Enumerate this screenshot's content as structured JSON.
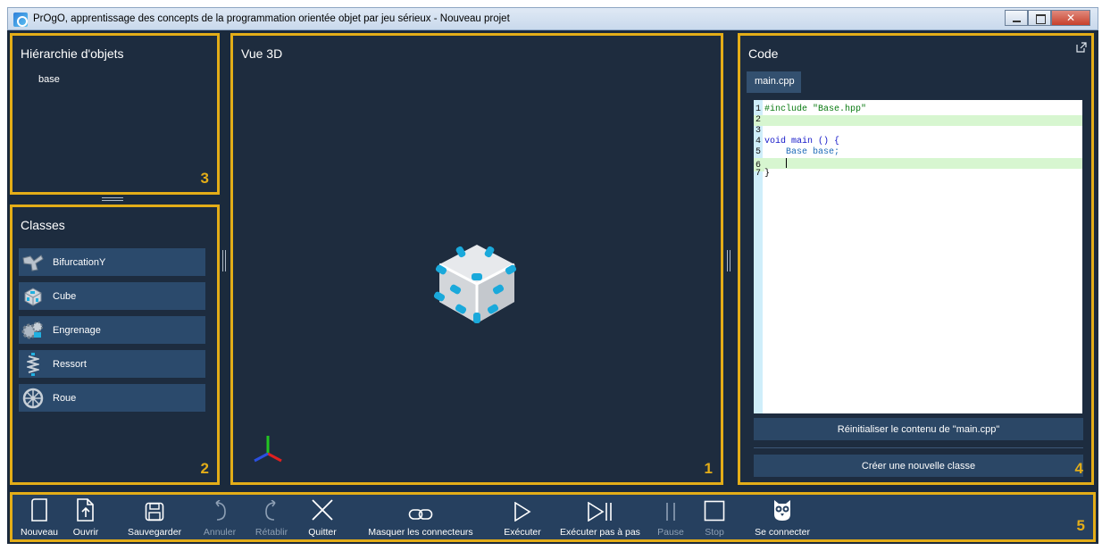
{
  "window": {
    "title": "PrOgO, apprentissage des concepts de la programmation orientée objet par jeu sérieux - Nouveau projet"
  },
  "panels": {
    "hierarchy": {
      "title": "Hiérarchie d'objets",
      "number": "3",
      "items": [
        "base"
      ]
    },
    "classes": {
      "title": "Classes",
      "number": "2",
      "items": [
        {
          "label": "BifurcationY",
          "icon": "bifurcation-icon"
        },
        {
          "label": "Cube",
          "icon": "cube-icon"
        },
        {
          "label": "Engrenage",
          "icon": "gear-piece-icon"
        },
        {
          "label": "Ressort",
          "icon": "spring-icon"
        },
        {
          "label": "Roue",
          "icon": "wheel-icon"
        }
      ]
    },
    "view3d": {
      "title": "Vue 3D",
      "number": "1"
    },
    "code": {
      "title": "Code",
      "number": "4",
      "tab": "main.cpp",
      "lines": [
        {
          "n": "1",
          "text": "#include \"Base.hpp\"",
          "highlight": false
        },
        {
          "n": "2",
          "text": "",
          "highlight": true
        },
        {
          "n": "3",
          "text": "",
          "highlight": false
        },
        {
          "n": "4",
          "text": "void main () {",
          "highlight": false
        },
        {
          "n": "5",
          "text": "    Base base;",
          "highlight": false
        },
        {
          "n": "6",
          "text": "    ",
          "highlight": true
        },
        {
          "n": "7",
          "text": "}",
          "highlight": false
        }
      ],
      "reset_button": "Réinitialiser le contenu de \"main.cpp\"",
      "new_class_button": "Créer une nouvelle classe"
    },
    "toolbar": {
      "number": "5",
      "buttons": [
        {
          "label": "Nouveau",
          "icon": "new-file-icon",
          "enabled": true
        },
        {
          "label": "Ouvrir",
          "icon": "open-file-icon",
          "enabled": true
        },
        {
          "label": "Sauvegarder",
          "icon": "save-icon",
          "enabled": true
        },
        {
          "label": "Annuler",
          "icon": "undo-icon",
          "enabled": false
        },
        {
          "label": "Rétablir",
          "icon": "redo-icon",
          "enabled": false
        },
        {
          "label": "Quitter",
          "icon": "close-icon",
          "enabled": true
        },
        {
          "label": "Masquer les connecteurs",
          "icon": "link-icon",
          "enabled": true
        },
        {
          "label": "Exécuter",
          "icon": "play-icon",
          "enabled": true
        },
        {
          "label": "Exécuter pas à pas",
          "icon": "step-icon",
          "enabled": true
        },
        {
          "label": "Pause",
          "icon": "pause-icon",
          "enabled": false
        },
        {
          "label": "Stop",
          "icon": "stop-icon",
          "enabled": false
        },
        {
          "label": "Se connecter",
          "icon": "owl-icon",
          "enabled": true
        }
      ]
    }
  },
  "colors": {
    "panel_border": "#e3ad18",
    "background": "#1b2a3c",
    "toolbar": "#26405f",
    "list_item": "#2b4a6c"
  }
}
